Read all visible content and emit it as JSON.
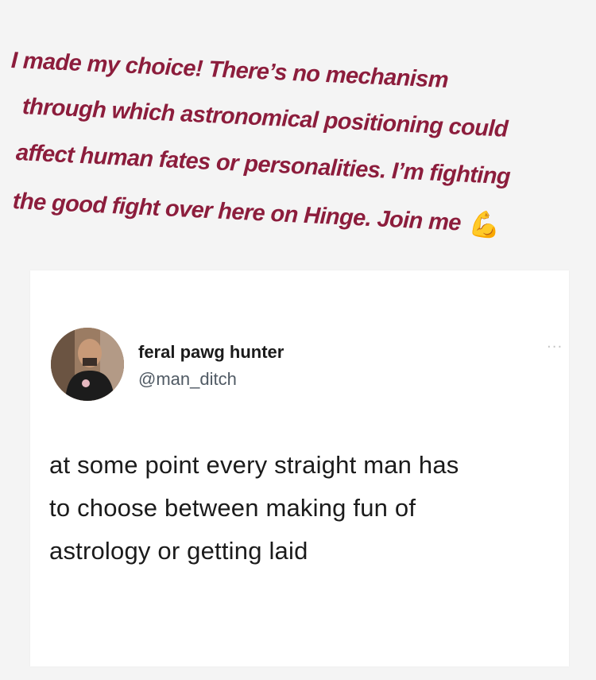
{
  "story": {
    "caption_lines": [
      "I made my choice! There’s no mechanism",
      "through which astronomical positioning could",
      "affect human fates or personalities. I’m fighting",
      "the good fight over here on Hinge. Join me"
    ],
    "caption_emoji": "💪",
    "caption_color": "#8c1d3c"
  },
  "tweet": {
    "display_name": "feral pawg hunter",
    "handle": "@man_ditch",
    "more_icon": "···",
    "text_lines": [
      "at some point every straight man has",
      "to choose between making fun of",
      "astrology or getting laid"
    ]
  }
}
